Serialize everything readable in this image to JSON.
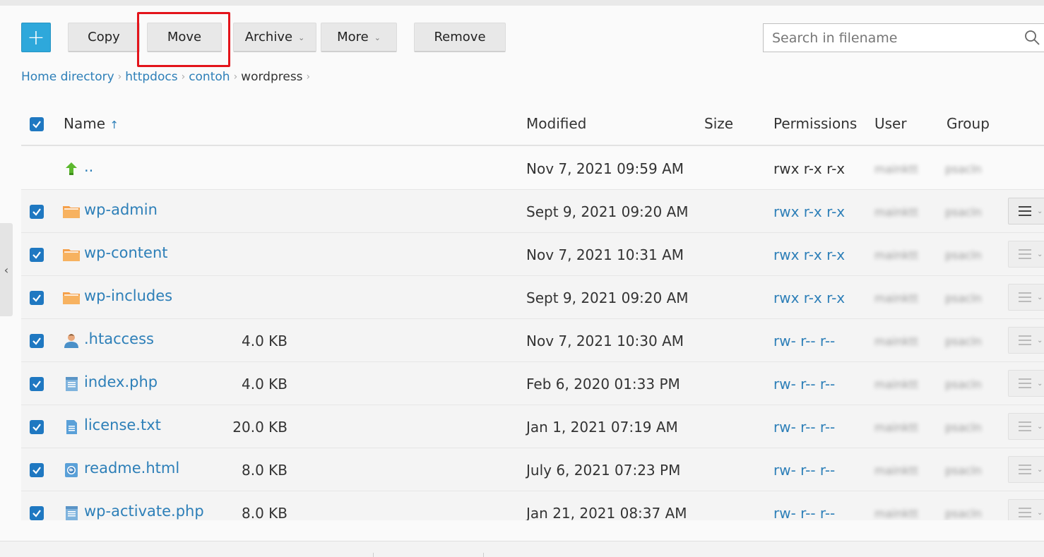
{
  "toolbar": {
    "add_label": "+",
    "copy_label": "Copy",
    "move_label": "Move",
    "archive_label": "Archive",
    "more_label": "More",
    "remove_label": "Remove"
  },
  "search": {
    "placeholder": "Search in filename"
  },
  "breadcrumb": {
    "items": [
      "Home directory",
      "httpdocs",
      "contoh"
    ],
    "current": "wordpress"
  },
  "table": {
    "headers": {
      "name": "Name",
      "sort_indicator": "↑",
      "modified": "Modified",
      "size": "Size",
      "permissions": "Permissions",
      "user": "User",
      "group": "Group"
    },
    "rows": [
      {
        "name": "..",
        "icon": "parent-folder-icon",
        "modified": "Nov 7, 2021 09:59 AM",
        "size": "",
        "permissions": "rwx r-x r-x",
        "user": "mainktt",
        "group": "psacln",
        "checked": false
      },
      {
        "name": "wp-admin",
        "icon": "folder-icon",
        "modified": "Sept 9, 2021 09:20 AM",
        "size": "",
        "permissions": "rwx r-x r-x",
        "user": "mainktt",
        "group": "psacln",
        "checked": true
      },
      {
        "name": "wp-content",
        "icon": "folder-icon",
        "modified": "Nov 7, 2021 10:31 AM",
        "size": "",
        "permissions": "rwx r-x r-x",
        "user": "mainktt",
        "group": "psacln",
        "checked": true
      },
      {
        "name": "wp-includes",
        "icon": "folder-icon",
        "modified": "Sept 9, 2021 09:20 AM",
        "size": "",
        "permissions": "rwx r-x r-x",
        "user": "mainktt",
        "group": "psacln",
        "checked": true
      },
      {
        "name": ".htaccess",
        "icon": "user-file-icon",
        "modified": "Nov 7, 2021 10:30 AM",
        "size": "4.0 KB",
        "permissions": "rw- r-- r--",
        "user": "mainktt",
        "group": "psacln",
        "checked": true
      },
      {
        "name": "index.php",
        "icon": "php-file-icon",
        "modified": "Feb 6, 2020 01:33 PM",
        "size": "4.0 KB",
        "permissions": "rw- r-- r--",
        "user": "mainktt",
        "group": "psacln",
        "checked": true
      },
      {
        "name": "license.txt",
        "icon": "text-file-icon",
        "modified": "Jan 1, 2021 07:19 AM",
        "size": "20.0 KB",
        "permissions": "rw- r-- r--",
        "user": "mainktt",
        "group": "psacln",
        "checked": true
      },
      {
        "name": "readme.html",
        "icon": "html-file-icon",
        "modified": "July 6, 2021 07:23 PM",
        "size": "8.0 KB",
        "permissions": "rw- r-- r--",
        "user": "mainktt",
        "group": "psacln",
        "checked": true
      },
      {
        "name": "wp-activate.php",
        "icon": "php-file-icon",
        "modified": "Jan 21, 2021 08:37 AM",
        "size": "8.0 KB",
        "permissions": "rw- r-- r--",
        "user": "mainktt",
        "group": "psacln",
        "checked": true
      }
    ]
  },
  "side_tab": {
    "label": "‹"
  },
  "colors": {
    "accent": "#2ea8db",
    "link": "#2d7fb8",
    "checkbox": "#1f78c1",
    "highlight": "#e3141b",
    "folder": "#f5a04a"
  }
}
